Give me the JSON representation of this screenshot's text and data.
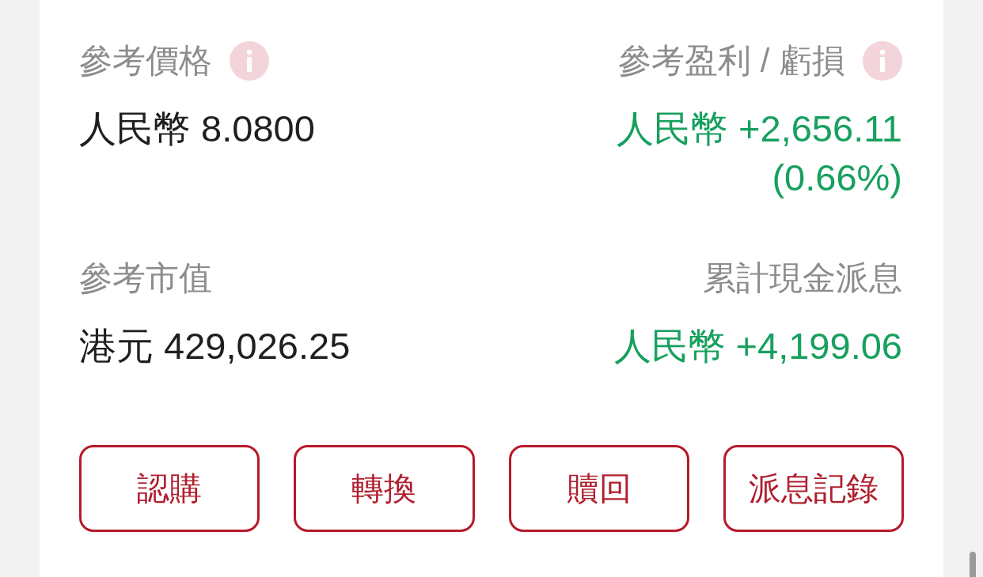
{
  "metrics": [
    {
      "label": "參考價格",
      "info_icon": true,
      "value": "人民幣 8.0800",
      "positive": false
    },
    {
      "label": "參考盈利 / 虧損",
      "info_icon": true,
      "value": "人民幣 +2,656.11",
      "change": "(0.66%)",
      "positive": true
    },
    {
      "label": "參考市值",
      "info_icon": false,
      "value": "港元 429,026.25",
      "positive": false
    },
    {
      "label": "累計現金派息",
      "info_icon": false,
      "value": "人民幣 +4,199.06",
      "positive": true
    }
  ],
  "actions": [
    "認購",
    "轉換",
    "贖回",
    "派息記錄"
  ]
}
